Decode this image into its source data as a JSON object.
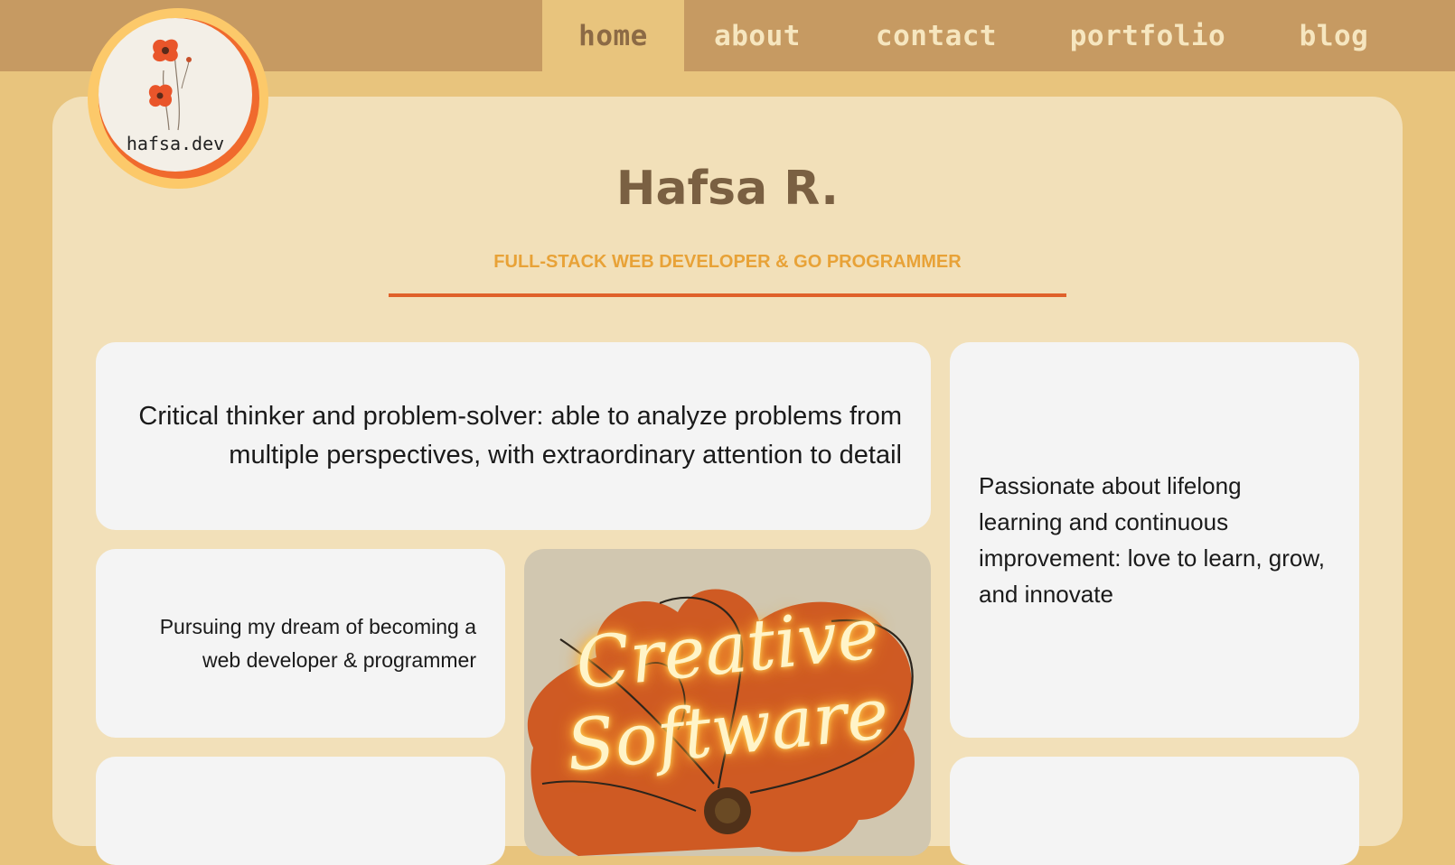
{
  "nav": {
    "items": [
      {
        "label": "home",
        "active": true
      },
      {
        "label": "about",
        "active": false
      },
      {
        "label": "contact",
        "active": false
      },
      {
        "label": "portfolio",
        "active": false
      },
      {
        "label": "blog",
        "active": false
      }
    ]
  },
  "logo": {
    "text": "hafsa.dev",
    "icon": "poppy-flower-icon"
  },
  "hero": {
    "name": "Hafsa R.",
    "tagline": "FULL-STACK WEB DEVELOPER & GO PROGRAMMER"
  },
  "cards": {
    "critical_thinker": "Critical thinker and problem-solver: able to analyze problems from multiple perspectives, with extraordinary attention to detail",
    "lifelong_learning": "Passionate about lifelong learning and continuous improvement: love to learn, grow, and innovate",
    "dream": "Pursuing my dream of becoming a web developer & programmer",
    "image": {
      "line1": "Creative",
      "line2": "Software"
    }
  },
  "colors": {
    "nav_bg": "#c69a62",
    "page_bg": "#e8c47d",
    "panel_bg": "#f2e0b9",
    "accent_orange": "#e0612a",
    "tagline_gold": "#e8a237",
    "title_brown": "#7a6042"
  }
}
